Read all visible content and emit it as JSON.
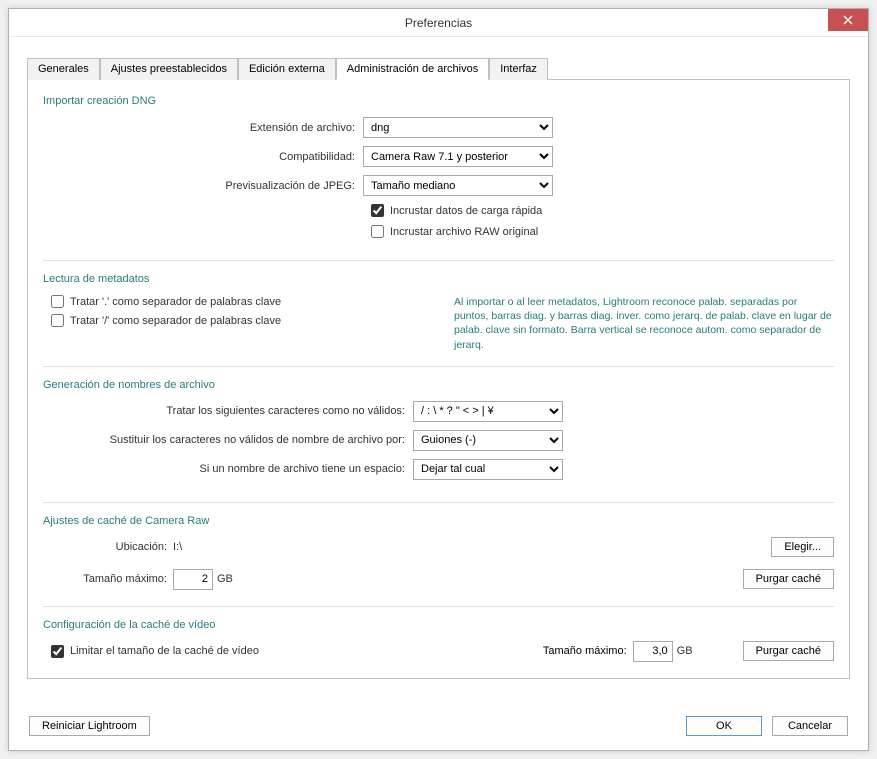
{
  "window": {
    "title": "Preferencias"
  },
  "tabs": {
    "generales": "Generales",
    "ajustes": "Ajustes preestablecidos",
    "edicion": "Edición externa",
    "archivos": "Administración de archivos",
    "interfaz": "Interfaz"
  },
  "dng": {
    "title": "Importar creación DNG",
    "ext_label": "Extensión de archivo:",
    "ext_value": "dng",
    "compat_label": "Compatibilidad:",
    "compat_value": "Camera Raw 7.1 y posterior",
    "jpeg_label": "Previsualización de JPEG:",
    "jpeg_value": "Tamaño mediano",
    "fastload_label": "Incrustar datos de carga rápida",
    "rawincl_label": "Incrustar archivo RAW original"
  },
  "meta": {
    "title": "Lectura de metadatos",
    "dot_label": "Tratar '.' como separador de palabras clave",
    "slash_label": "Tratar '/' como separador de palabras clave",
    "help": "Al importar o al leer metadatos, Lightroom reconoce palab. separadas por puntos, barras diag. y barras diag. inver. como jerarq. de palab. clave en lugar de palab. clave sin formato. Barra vertical se reconoce autom. como separador de jerarq."
  },
  "fname": {
    "title": "Generación de nombres de archivo",
    "illegal_label": "Tratar los siguientes caracteres como no válidos:",
    "illegal_value": "/ : \\ * ? \" < > | ¥",
    "replace_label": "Sustituir los caracteres no válidos de nombre de archivo por:",
    "replace_value": "Guiones (-)",
    "space_label": "Si un nombre de archivo tiene un espacio:",
    "space_value": "Dejar tal cual"
  },
  "cache": {
    "title": "Ajustes de caché de Camera Raw",
    "loc_label": "Ubicación:",
    "loc_value": "I:\\",
    "choose": "Elegir...",
    "max_label": "Tamaño máximo:",
    "max_value": "2",
    "unit": "GB",
    "purge": "Purgar caché"
  },
  "video": {
    "title": "Configuración de la caché de vídeo",
    "limit_label": "Limitar el tamaño de la caché de vídeo",
    "max_label": "Tamaño máximo:",
    "max_value": "3,0",
    "unit": "GB",
    "purge": "Purgar caché"
  },
  "footer": {
    "restart": "Reiniciar Lightroom",
    "ok": "OK",
    "cancel": "Cancelar"
  }
}
